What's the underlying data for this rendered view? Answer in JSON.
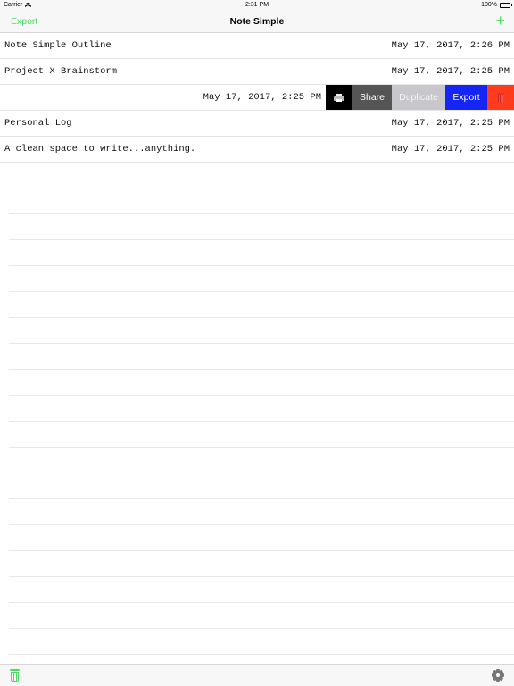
{
  "status_bar": {
    "carrier": "Carrier",
    "time": "2:31 PM",
    "battery": "100%"
  },
  "nav": {
    "left_button": "Export",
    "title": "Note Simple",
    "add_icon": "plus-icon"
  },
  "notes": [
    {
      "title": "Note Simple Outline",
      "date": "May 17, 2017, 2:26 PM"
    },
    {
      "title": "Project X Brainstorm",
      "date": "May 17, 2017, 2:25 PM"
    },
    {
      "title": "",
      "date": "May 17, 2017, 2:25 PM"
    },
    {
      "title": "Personal Log",
      "date": "May 17, 2017, 2:25 PM"
    },
    {
      "title": "A clean space to write...anything.",
      "date": "May 17, 2017, 2:25 PM"
    }
  ],
  "swipe_actions": {
    "print_icon": "printer-icon",
    "share": "Share",
    "duplicate": "Duplicate",
    "export": "Export",
    "delete_icon": "trash-icon"
  },
  "toolbar": {
    "left_icon": "trash-icon",
    "right_icon": "gear-icon"
  },
  "colors": {
    "accent": "#4cd964",
    "share_bg": "#555555",
    "duplicate_bg": "#c7c7cc",
    "export_bg": "#1425f5",
    "delete_bg": "#ff3b1c"
  }
}
